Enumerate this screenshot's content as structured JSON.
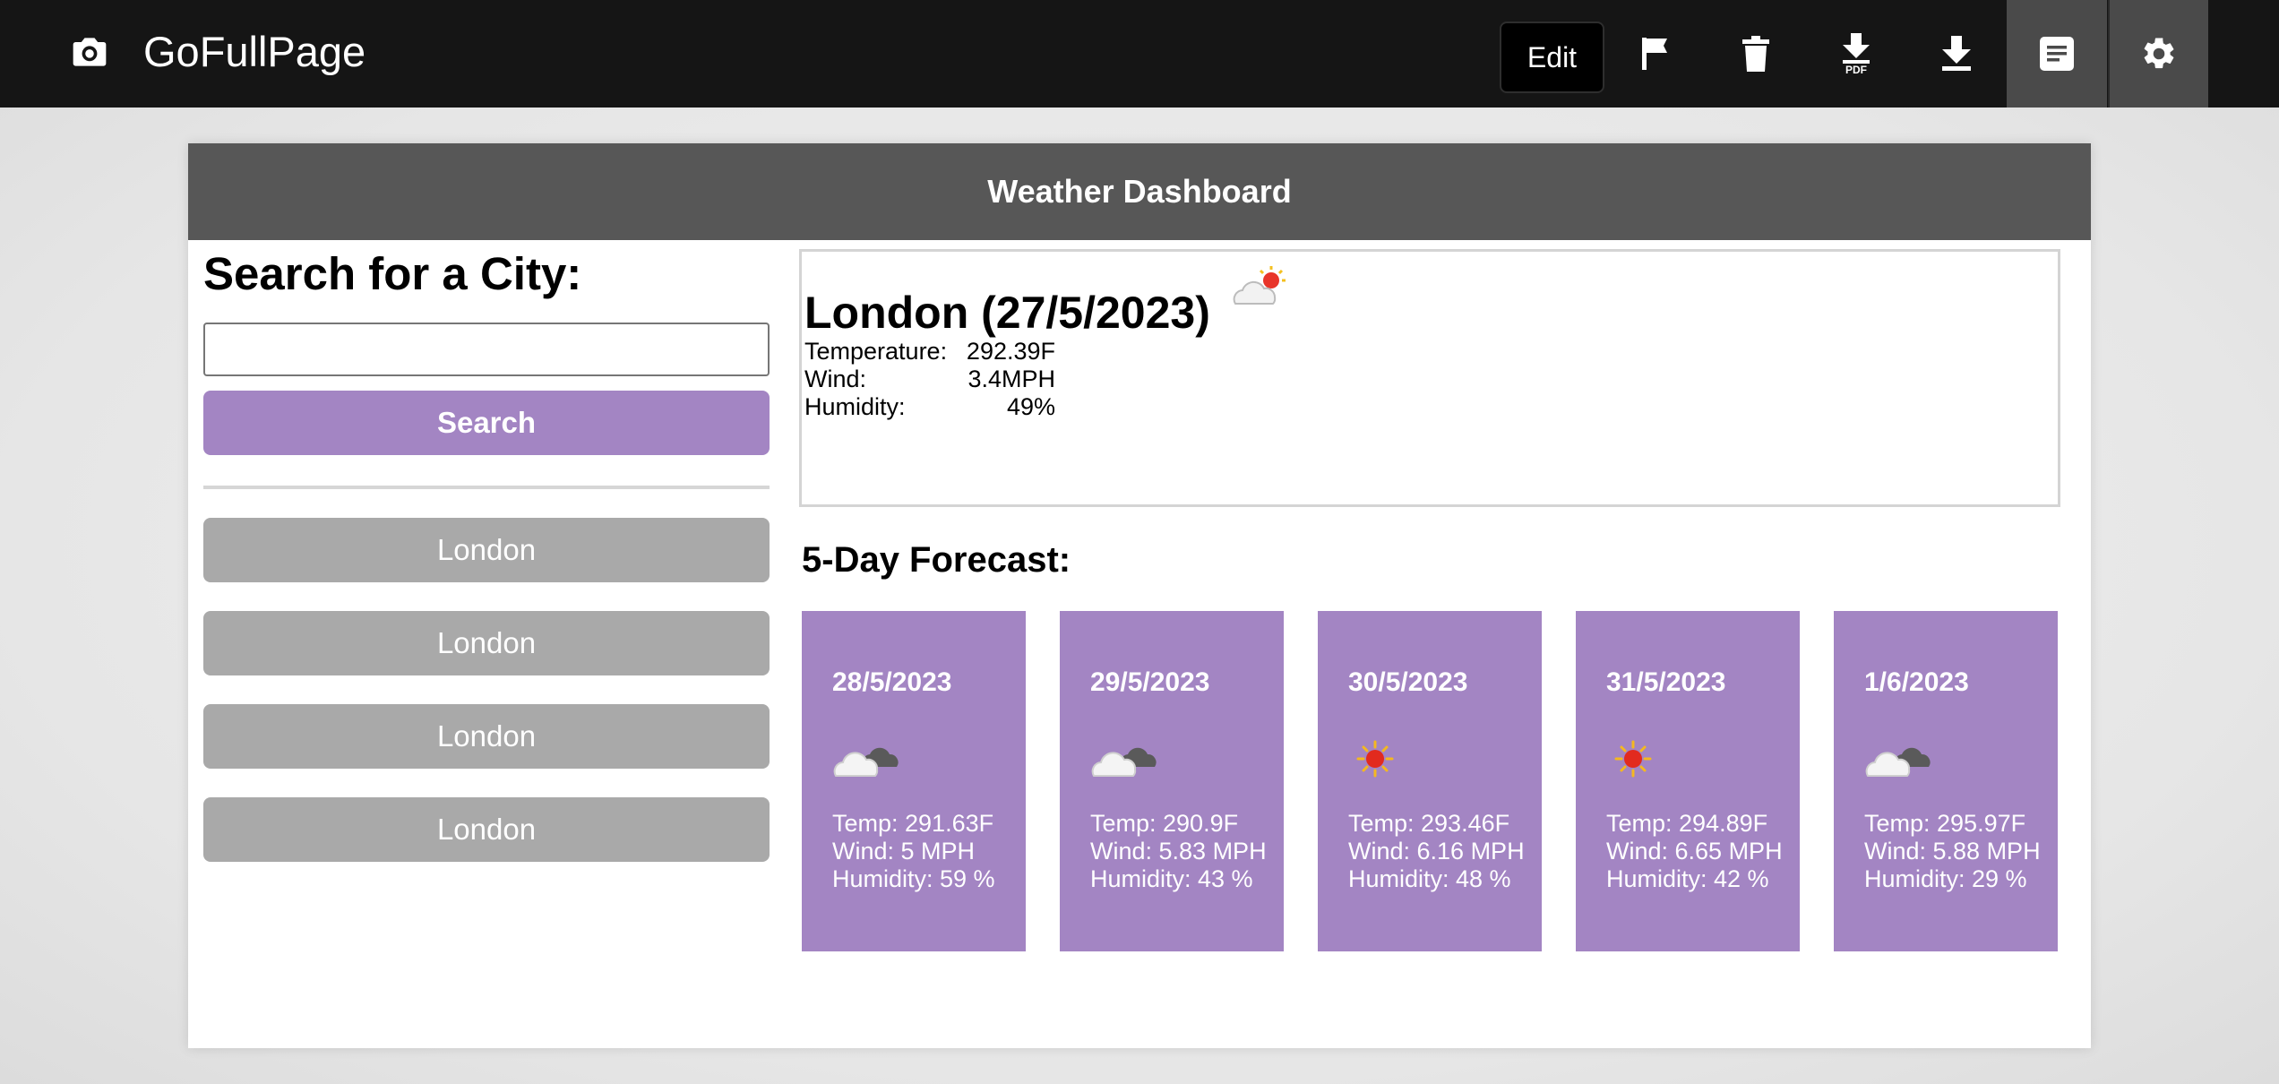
{
  "toolbar": {
    "app_name": "GoFullPage",
    "edit_label": "Edit",
    "icons": [
      "camera-icon",
      "flag-icon",
      "trash-icon",
      "download-pdf-icon",
      "download-icon",
      "notes-icon",
      "gear-icon"
    ],
    "pdf_badge": "PDF"
  },
  "page": {
    "header": "Weather Dashboard",
    "search_title": "Search for a City:",
    "search_placeholder": "",
    "search_value": "",
    "search_button": "Search",
    "history": [
      "London",
      "London",
      "London",
      "London"
    ]
  },
  "current": {
    "title": "London (27/5/2023)",
    "icon": "partly-cloudy-icon",
    "temperature_label": "Temperature:",
    "temperature_value": "292.39F",
    "wind_label": "Wind:",
    "wind_value": "3.4MPH",
    "humidity_label": "Humidity:",
    "humidity_value": "49%"
  },
  "forecast": {
    "title": "5-Day Forecast:",
    "days": [
      {
        "date": "28/5/2023",
        "icon": "cloud-icon",
        "temp": "Temp: 291.63F",
        "wind": "Wind: 5 MPH",
        "humidity": "Humidity: 59 %"
      },
      {
        "date": "29/5/2023",
        "icon": "cloud-icon",
        "temp": "Temp: 290.9F",
        "wind": "Wind: 5.83 MPH",
        "humidity": "Humidity: 43 %"
      },
      {
        "date": "30/5/2023",
        "icon": "sun-icon",
        "temp": "Temp: 293.46F",
        "wind": "Wind: 6.16 MPH",
        "humidity": "Humidity: 48 %"
      },
      {
        "date": "31/5/2023",
        "icon": "sun-icon",
        "temp": "Temp: 294.89F",
        "wind": "Wind: 6.65 MPH",
        "humidity": "Humidity: 42 %"
      },
      {
        "date": "1/6/2023",
        "icon": "cloud-icon",
        "temp": "Temp: 295.97F",
        "wind": "Wind: 5.88 MPH",
        "humidity": "Humidity: 29 %"
      }
    ]
  },
  "colors": {
    "toolbar_bg": "#151515",
    "header_bg": "#575757",
    "accent_purple": "#a385c3",
    "history_gray": "#a9a9a9"
  }
}
